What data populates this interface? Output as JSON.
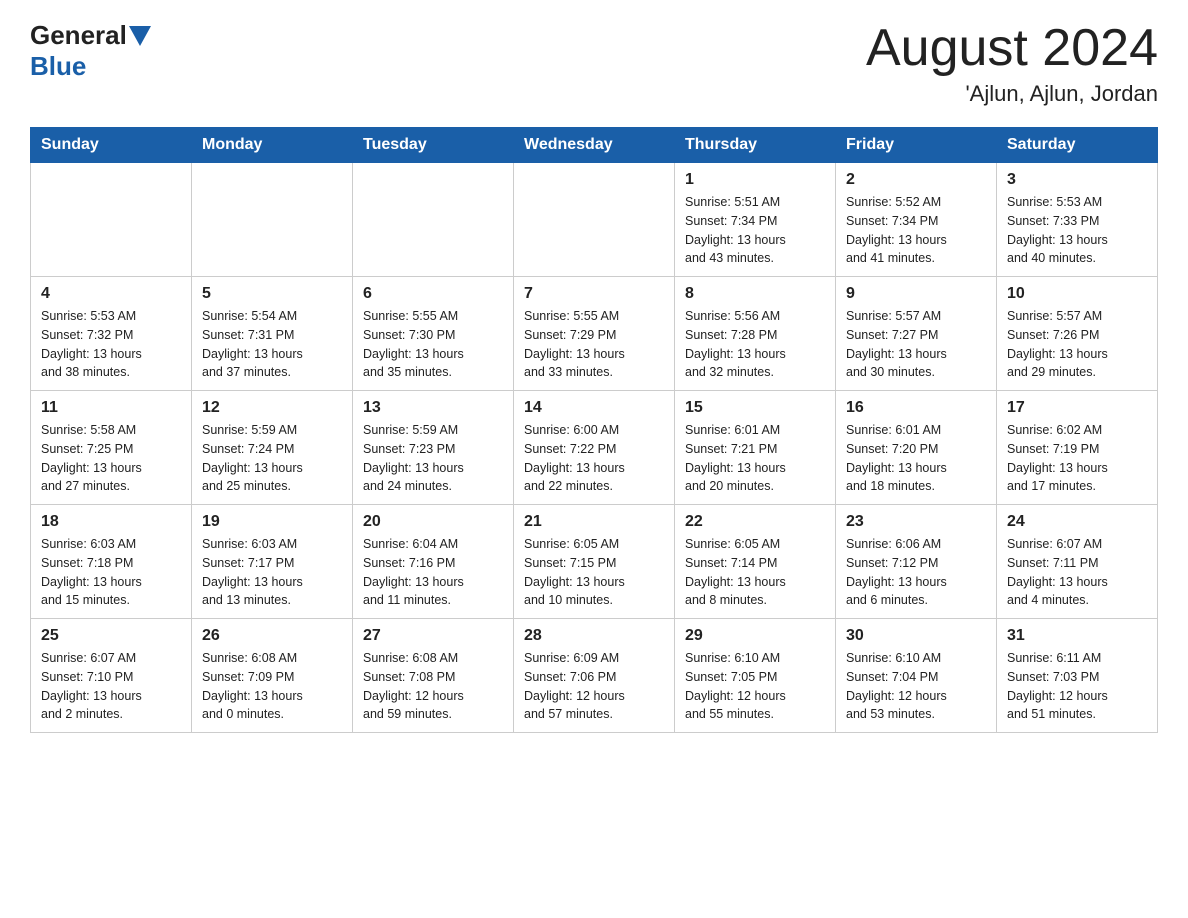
{
  "header": {
    "logo_general": "General",
    "logo_blue": "Blue",
    "month_year": "August 2024",
    "location": "'Ajlun, Ajlun, Jordan"
  },
  "days_of_week": [
    "Sunday",
    "Monday",
    "Tuesday",
    "Wednesday",
    "Thursday",
    "Friday",
    "Saturday"
  ],
  "weeks": [
    [
      {
        "day": "",
        "info": ""
      },
      {
        "day": "",
        "info": ""
      },
      {
        "day": "",
        "info": ""
      },
      {
        "day": "",
        "info": ""
      },
      {
        "day": "1",
        "info": "Sunrise: 5:51 AM\nSunset: 7:34 PM\nDaylight: 13 hours\nand 43 minutes."
      },
      {
        "day": "2",
        "info": "Sunrise: 5:52 AM\nSunset: 7:34 PM\nDaylight: 13 hours\nand 41 minutes."
      },
      {
        "day": "3",
        "info": "Sunrise: 5:53 AM\nSunset: 7:33 PM\nDaylight: 13 hours\nand 40 minutes."
      }
    ],
    [
      {
        "day": "4",
        "info": "Sunrise: 5:53 AM\nSunset: 7:32 PM\nDaylight: 13 hours\nand 38 minutes."
      },
      {
        "day": "5",
        "info": "Sunrise: 5:54 AM\nSunset: 7:31 PM\nDaylight: 13 hours\nand 37 minutes."
      },
      {
        "day": "6",
        "info": "Sunrise: 5:55 AM\nSunset: 7:30 PM\nDaylight: 13 hours\nand 35 minutes."
      },
      {
        "day": "7",
        "info": "Sunrise: 5:55 AM\nSunset: 7:29 PM\nDaylight: 13 hours\nand 33 minutes."
      },
      {
        "day": "8",
        "info": "Sunrise: 5:56 AM\nSunset: 7:28 PM\nDaylight: 13 hours\nand 32 minutes."
      },
      {
        "day": "9",
        "info": "Sunrise: 5:57 AM\nSunset: 7:27 PM\nDaylight: 13 hours\nand 30 minutes."
      },
      {
        "day": "10",
        "info": "Sunrise: 5:57 AM\nSunset: 7:26 PM\nDaylight: 13 hours\nand 29 minutes."
      }
    ],
    [
      {
        "day": "11",
        "info": "Sunrise: 5:58 AM\nSunset: 7:25 PM\nDaylight: 13 hours\nand 27 minutes."
      },
      {
        "day": "12",
        "info": "Sunrise: 5:59 AM\nSunset: 7:24 PM\nDaylight: 13 hours\nand 25 minutes."
      },
      {
        "day": "13",
        "info": "Sunrise: 5:59 AM\nSunset: 7:23 PM\nDaylight: 13 hours\nand 24 minutes."
      },
      {
        "day": "14",
        "info": "Sunrise: 6:00 AM\nSunset: 7:22 PM\nDaylight: 13 hours\nand 22 minutes."
      },
      {
        "day": "15",
        "info": "Sunrise: 6:01 AM\nSunset: 7:21 PM\nDaylight: 13 hours\nand 20 minutes."
      },
      {
        "day": "16",
        "info": "Sunrise: 6:01 AM\nSunset: 7:20 PM\nDaylight: 13 hours\nand 18 minutes."
      },
      {
        "day": "17",
        "info": "Sunrise: 6:02 AM\nSunset: 7:19 PM\nDaylight: 13 hours\nand 17 minutes."
      }
    ],
    [
      {
        "day": "18",
        "info": "Sunrise: 6:03 AM\nSunset: 7:18 PM\nDaylight: 13 hours\nand 15 minutes."
      },
      {
        "day": "19",
        "info": "Sunrise: 6:03 AM\nSunset: 7:17 PM\nDaylight: 13 hours\nand 13 minutes."
      },
      {
        "day": "20",
        "info": "Sunrise: 6:04 AM\nSunset: 7:16 PM\nDaylight: 13 hours\nand 11 minutes."
      },
      {
        "day": "21",
        "info": "Sunrise: 6:05 AM\nSunset: 7:15 PM\nDaylight: 13 hours\nand 10 minutes."
      },
      {
        "day": "22",
        "info": "Sunrise: 6:05 AM\nSunset: 7:14 PM\nDaylight: 13 hours\nand 8 minutes."
      },
      {
        "day": "23",
        "info": "Sunrise: 6:06 AM\nSunset: 7:12 PM\nDaylight: 13 hours\nand 6 minutes."
      },
      {
        "day": "24",
        "info": "Sunrise: 6:07 AM\nSunset: 7:11 PM\nDaylight: 13 hours\nand 4 minutes."
      }
    ],
    [
      {
        "day": "25",
        "info": "Sunrise: 6:07 AM\nSunset: 7:10 PM\nDaylight: 13 hours\nand 2 minutes."
      },
      {
        "day": "26",
        "info": "Sunrise: 6:08 AM\nSunset: 7:09 PM\nDaylight: 13 hours\nand 0 minutes."
      },
      {
        "day": "27",
        "info": "Sunrise: 6:08 AM\nSunset: 7:08 PM\nDaylight: 12 hours\nand 59 minutes."
      },
      {
        "day": "28",
        "info": "Sunrise: 6:09 AM\nSunset: 7:06 PM\nDaylight: 12 hours\nand 57 minutes."
      },
      {
        "day": "29",
        "info": "Sunrise: 6:10 AM\nSunset: 7:05 PM\nDaylight: 12 hours\nand 55 minutes."
      },
      {
        "day": "30",
        "info": "Sunrise: 6:10 AM\nSunset: 7:04 PM\nDaylight: 12 hours\nand 53 minutes."
      },
      {
        "day": "31",
        "info": "Sunrise: 6:11 AM\nSunset: 7:03 PM\nDaylight: 12 hours\nand 51 minutes."
      }
    ]
  ]
}
